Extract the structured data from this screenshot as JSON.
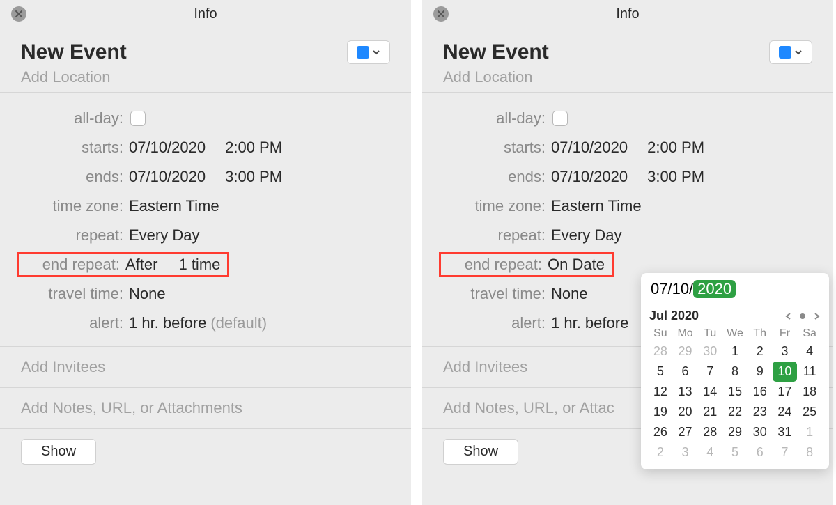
{
  "left": {
    "window_title": "Info",
    "event_title": "New Event",
    "add_location": "Add Location",
    "labels": {
      "allday": "all-day:",
      "starts": "starts:",
      "ends": "ends:",
      "timezone": "time zone:",
      "repeat": "repeat:",
      "end_repeat": "end repeat:",
      "travel": "travel time:",
      "alert": "alert:"
    },
    "values": {
      "starts_date": "07/10/2020",
      "starts_time": "2:00 PM",
      "ends_date": "07/10/2020",
      "ends_time": "3:00 PM",
      "timezone": "Eastern Time",
      "repeat": "Every Day",
      "end_repeat_mode": "After",
      "end_repeat_count": "1 time",
      "travel": "None",
      "alert": "1 hr. before",
      "alert_suffix": "(default)"
    },
    "invitees": "Add Invitees",
    "notes": "Add Notes, URL, or Attachments",
    "show_btn": "Show"
  },
  "right": {
    "window_title": "Info",
    "event_title": "New Event",
    "add_location": "Add Location",
    "labels": {
      "allday": "all-day:",
      "starts": "starts:",
      "ends": "ends:",
      "timezone": "time zone:",
      "repeat": "repeat:",
      "end_repeat": "end repeat:",
      "travel": "travel time:",
      "alert": "alert:"
    },
    "values": {
      "starts_date": "07/10/2020",
      "starts_time": "2:00 PM",
      "ends_date": "07/10/2020",
      "ends_time": "3:00 PM",
      "timezone": "Eastern Time",
      "repeat": "Every Day",
      "end_repeat_mode": "On Date",
      "travel": "None",
      "alert": "1 hr. before"
    },
    "invitees": "Add Invitees",
    "notes": "Add Notes, URL, or Attac",
    "show_btn": "Show",
    "date_popover": {
      "input_prefix": "07/10/",
      "input_year": "2020",
      "month_label": "Jul 2020",
      "dow": [
        "Su",
        "Mo",
        "Tu",
        "We",
        "Th",
        "Fr",
        "Sa"
      ],
      "weeks": [
        [
          {
            "d": "28",
            "m": true
          },
          {
            "d": "29",
            "m": true
          },
          {
            "d": "30",
            "m": true
          },
          {
            "d": "1"
          },
          {
            "d": "2"
          },
          {
            "d": "3"
          },
          {
            "d": "4"
          }
        ],
        [
          {
            "d": "5"
          },
          {
            "d": "6"
          },
          {
            "d": "7"
          },
          {
            "d": "8"
          },
          {
            "d": "9"
          },
          {
            "d": "10",
            "sel": true
          },
          {
            "d": "11"
          }
        ],
        [
          {
            "d": "12"
          },
          {
            "d": "13"
          },
          {
            "d": "14"
          },
          {
            "d": "15"
          },
          {
            "d": "16"
          },
          {
            "d": "17"
          },
          {
            "d": "18"
          }
        ],
        [
          {
            "d": "19"
          },
          {
            "d": "20"
          },
          {
            "d": "21"
          },
          {
            "d": "22"
          },
          {
            "d": "23"
          },
          {
            "d": "24"
          },
          {
            "d": "25"
          }
        ],
        [
          {
            "d": "26"
          },
          {
            "d": "27"
          },
          {
            "d": "28"
          },
          {
            "d": "29"
          },
          {
            "d": "30"
          },
          {
            "d": "31"
          },
          {
            "d": "1",
            "m": true
          }
        ],
        [
          {
            "d": "2",
            "m": true
          },
          {
            "d": "3",
            "m": true
          },
          {
            "d": "4",
            "m": true
          },
          {
            "d": "5",
            "m": true
          },
          {
            "d": "6",
            "m": true
          },
          {
            "d": "7",
            "m": true
          },
          {
            "d": "8",
            "m": true
          }
        ]
      ]
    }
  },
  "colors": {
    "accent_blue": "#1e88ff",
    "highlight_red": "#ff3b30",
    "green": "#2ea043"
  }
}
